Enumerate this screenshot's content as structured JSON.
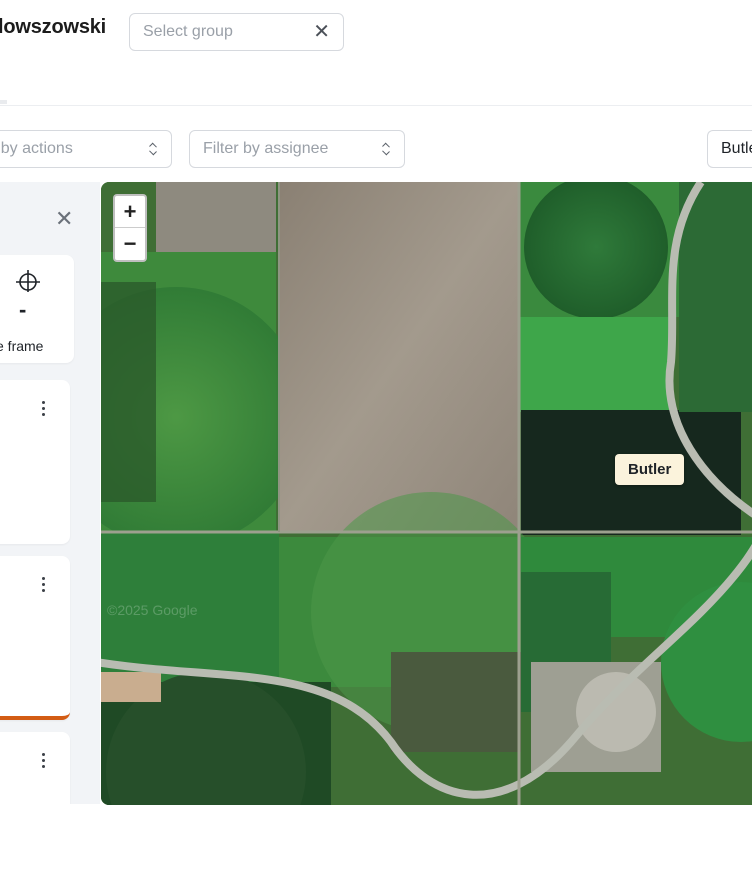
{
  "header": {
    "title": "lowszowski",
    "group_select_placeholder": "Select group"
  },
  "filters": {
    "actions_placeholder": "r by actions",
    "assignee_placeholder": "Filter by assignee",
    "right_value": "Butle"
  },
  "side_panel": {
    "frame_card": {
      "value": "-",
      "label": "e frame"
    }
  },
  "map": {
    "zoom_in": "+",
    "zoom_out": "−",
    "label": "Butler",
    "attribution": "©2025 Google"
  },
  "colors": {
    "accent": "#d35c14",
    "panel_bg": "#f2f4f7",
    "label_bg": "#fbf3dc"
  },
  "icons": [
    "close-icon",
    "chevron-updown-icon",
    "frame-icon",
    "kebab-menu-icon"
  ]
}
